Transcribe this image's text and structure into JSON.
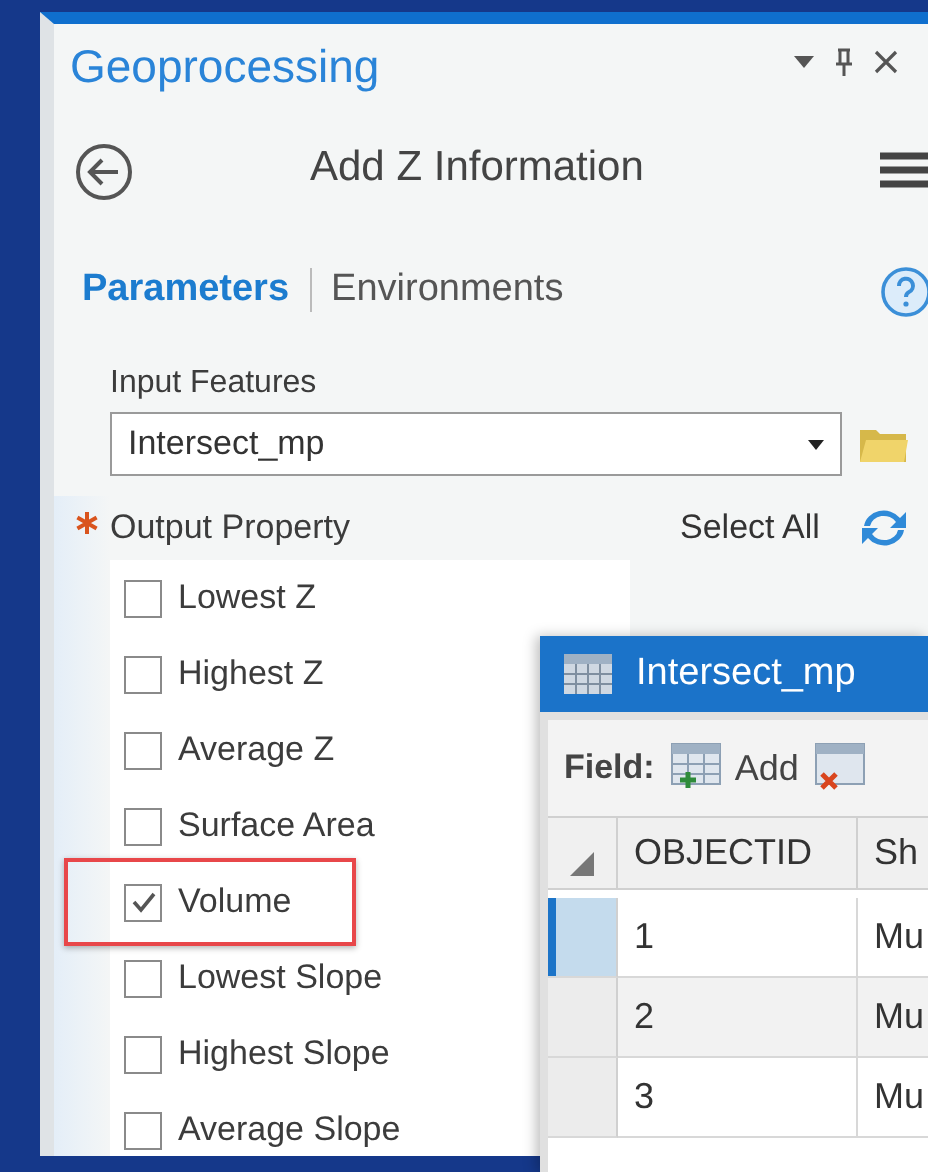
{
  "panel": {
    "title": "Geoprocessing",
    "tool_title": "Add Z Information",
    "tabs": [
      {
        "label": "Parameters",
        "selected": true
      },
      {
        "label": "Environments",
        "selected": false
      }
    ],
    "input_features": {
      "label": "Input Features",
      "value": "Intersect_mp"
    },
    "output_property": {
      "label": "Output Property",
      "required": true,
      "select_all": "Select All",
      "options": [
        {
          "label": "Lowest Z",
          "checked": false,
          "highlighted": false
        },
        {
          "label": "Highest Z",
          "checked": false,
          "highlighted": false
        },
        {
          "label": "Average Z",
          "checked": false,
          "highlighted": false
        },
        {
          "label": "Surface Area",
          "checked": false,
          "highlighted": false
        },
        {
          "label": "Volume",
          "checked": true,
          "highlighted": true
        },
        {
          "label": "Lowest Slope",
          "checked": false,
          "highlighted": false
        },
        {
          "label": "Highest Slope",
          "checked": false,
          "highlighted": false
        },
        {
          "label": "Average Slope",
          "checked": false,
          "highlighted": false
        }
      ]
    }
  },
  "table_window": {
    "title": "Intersect_mp",
    "toolbar_label": "Field:",
    "add_button": "Add",
    "columns": [
      "OBJECTID",
      "Sh"
    ],
    "rows": [
      {
        "cells": [
          "1",
          "Mu"
        ],
        "selected": true
      },
      {
        "cells": [
          "2",
          "Mu"
        ],
        "selected": false
      },
      {
        "cells": [
          "3",
          "Mu"
        ],
        "selected": false
      }
    ]
  }
}
